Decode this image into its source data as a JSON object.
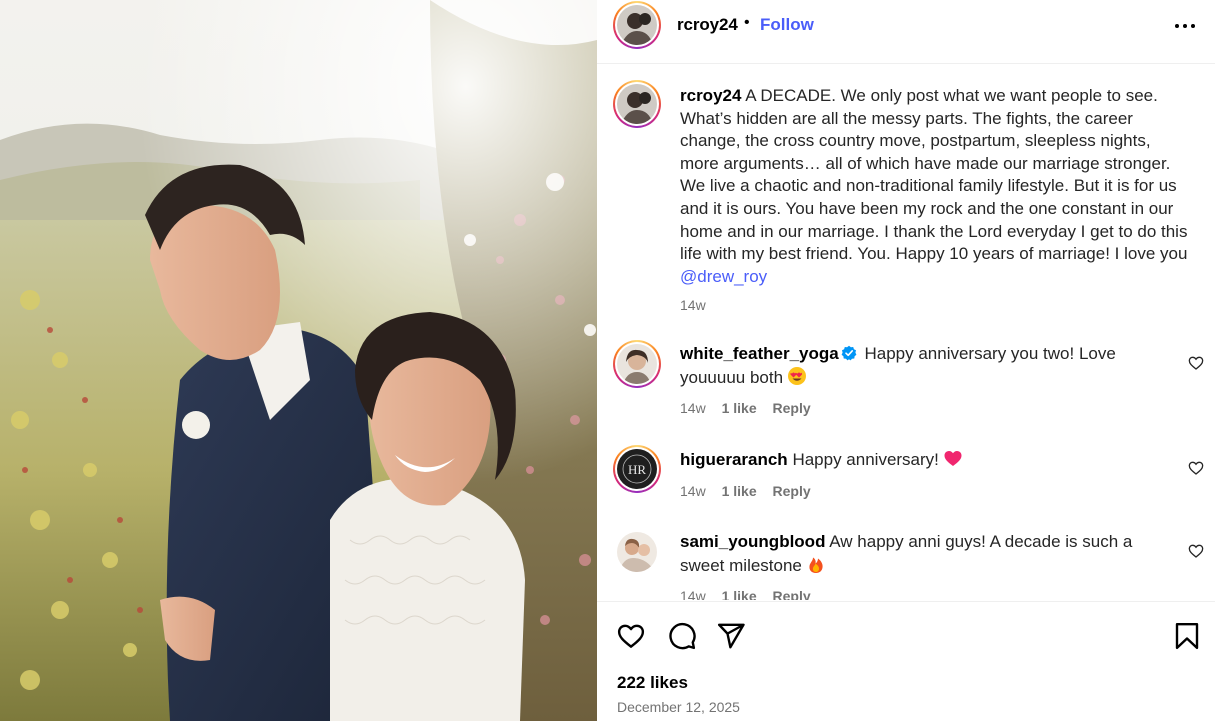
{
  "header": {
    "username": "rcroy24",
    "separator": "•",
    "follow_label": "Follow",
    "more_icon": "more-horizontal-icon"
  },
  "caption": {
    "username": "rcroy24",
    "text": "A DECADE. We only post what we want people to see. What’s hidden are all the messy parts. The fights, the career change, the cross country move, postpartum, sleepless nights, more arguments… all of which have made our marriage stronger. We live a chaotic and non-traditional family lifestyle. But it is for us and it is ours. You have been my rock and the one constant in our home and in our marriage. I thank the Lord everyday I get to do this life with my best friend. You. Happy 10 years of marriage! I love you",
    "mention": "@drew_roy",
    "time": "14w"
  },
  "comments": [
    {
      "username": "white_feather_yoga",
      "verified": true,
      "text": "Happy anniversary you two! Love youuuuu both",
      "emoji": "heart-eyes-emoji",
      "time": "14w",
      "likes": "1 like",
      "reply": "Reply"
    },
    {
      "username": "higueraranch",
      "verified": false,
      "text": "Happy anniversary!",
      "emoji": "pink-heart-emoji",
      "avatar_monogram": "HR",
      "time": "14w",
      "likes": "1 like",
      "reply": "Reply"
    },
    {
      "username": "sami_youngblood",
      "verified": false,
      "text": "Aw happy anni guys! A decade is such a sweet milestone",
      "emoji": "fire-emoji",
      "time": "14w",
      "likes": "1 like",
      "reply": "Reply"
    }
  ],
  "footer": {
    "likes": "222 likes",
    "date": "December 12, 2025",
    "icons": [
      "heart-icon",
      "comment-icon",
      "share-icon",
      "bookmark-icon"
    ]
  },
  "colors": {
    "link_blue": "#4a5df9",
    "muted_text": "#737373",
    "divider": "#efefef"
  }
}
